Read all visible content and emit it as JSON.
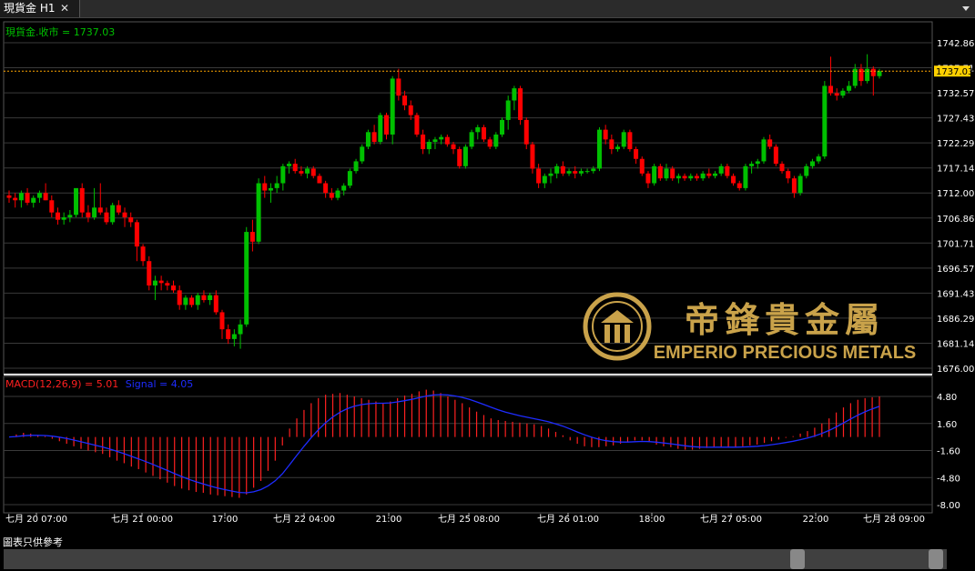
{
  "tab": {
    "title": "現貨金 H1",
    "close": "✕"
  },
  "price_legend": "現貨金.收市 = 1737.03",
  "current_price": "1737.03",
  "macd_legend": {
    "macd": "MACD(12,26,9) = 5.01",
    "signal": "Signal = 4.05"
  },
  "price_axis_labels": [
    "1742.86",
    "1737.71",
    "1732.57",
    "1727.43",
    "1722.29",
    "1717.14",
    "1712.00",
    "1706.86",
    "1701.71",
    "1696.57",
    "1691.43",
    "1686.29",
    "1681.14",
    "1676.00"
  ],
  "macd_axis_labels": [
    "4.80",
    "1.60",
    "-1.60",
    "-4.80",
    "-8.00"
  ],
  "time_labels": [
    "七月 20 07:00",
    "七月 21 00:00",
    "17:00",
    "七月 22 04:00",
    "21:00",
    "七月 25 08:00",
    "七月 26 01:00",
    "18:00",
    "七月 27 05:00",
    "22:00",
    "七月 28 09:00"
  ],
  "logo": {
    "chinese": "帝鋒貴金屬",
    "english": "EMPERIO PRECIOUS METALS"
  },
  "disclaimer": "圖表只供參考",
  "colors": {
    "up": "#00c000",
    "down": "#ff0000",
    "grid": "#3a3a3a",
    "axis_text": "#ffffff",
    "macd_bar": "#ff2020",
    "signal": "#1e2cff",
    "price_line": "#ffa500",
    "logo": "#c9a24a"
  },
  "chart_data": {
    "type": "candlestick",
    "ylim": [
      1676.0,
      1745.0
    ],
    "macd_ylim": [
      -8.0,
      6.0
    ],
    "candles": [
      [
        1711.5,
        1712.5,
        1710,
        1711
      ],
      [
        1711,
        1712,
        1709,
        1710.5
      ],
      [
        1710.5,
        1712.5,
        1709,
        1712
      ],
      [
        1712,
        1713,
        1709.5,
        1710
      ],
      [
        1710,
        1711.5,
        1709,
        1711
      ],
      [
        1711,
        1712.5,
        1710,
        1712
      ],
      [
        1712,
        1714,
        1710.5,
        1710.5
      ],
      [
        1710.5,
        1711.5,
        1707,
        1708
      ],
      [
        1708,
        1709,
        1705.5,
        1706.5
      ],
      [
        1706.5,
        1708,
        1705.5,
        1707
      ],
      [
        1707,
        1708.5,
        1706,
        1707.5
      ],
      [
        1707.5,
        1710,
        1707,
        1713
      ],
      [
        1713,
        1714,
        1707,
        1708
      ],
      [
        1708,
        1709.5,
        1706,
        1707
      ],
      [
        1707,
        1713,
        1706.5,
        1709
      ],
      [
        1709,
        1714,
        1707.5,
        1708
      ],
      [
        1708,
        1709,
        1705.5,
        1706
      ],
      [
        1706,
        1710,
        1705.5,
        1709.5
      ],
      [
        1709.5,
        1710.5,
        1707.5,
        1708
      ],
      [
        1708,
        1709,
        1705,
        1707
      ],
      [
        1707,
        1708,
        1705,
        1706
      ],
      [
        1706,
        1706.5,
        1698,
        1701
      ],
      [
        1701,
        1701.5,
        1697,
        1698
      ],
      [
        1698,
        1699,
        1692,
        1693
      ],
      [
        1693,
        1695,
        1690,
        1694
      ],
      [
        1694,
        1695,
        1692,
        1693.5
      ],
      [
        1693.5,
        1694,
        1692,
        1693
      ],
      [
        1693,
        1694,
        1691.5,
        1692
      ],
      [
        1692,
        1693,
        1688,
        1689
      ],
      [
        1689,
        1691,
        1688,
        1690.5
      ],
      [
        1690.5,
        1691,
        1688.5,
        1689
      ],
      [
        1689,
        1691.5,
        1688,
        1691
      ],
      [
        1691,
        1692,
        1689.5,
        1690
      ],
      [
        1690,
        1691.5,
        1689,
        1691
      ],
      [
        1691,
        1692,
        1687,
        1687.5
      ],
      [
        1687.5,
        1688,
        1682,
        1684
      ],
      [
        1684,
        1685,
        1681,
        1682
      ],
      [
        1682,
        1684,
        1680.5,
        1683
      ],
      [
        1683,
        1686,
        1680,
        1685
      ],
      [
        1685,
        1705,
        1684.5,
        1704
      ],
      [
        1704,
        1706.5,
        1700,
        1702
      ],
      [
        1702,
        1715,
        1701.5,
        1714
      ],
      [
        1714,
        1715.5,
        1711,
        1712.5
      ],
      [
        1712.5,
        1714,
        1710,
        1713
      ],
      [
        1713,
        1715.5,
        1712,
        1714
      ],
      [
        1714,
        1718,
        1712.5,
        1717.5
      ],
      [
        1717.5,
        1718.5,
        1716,
        1718
      ],
      [
        1718,
        1719,
        1716,
        1716.5
      ],
      [
        1716.5,
        1717.5,
        1715.5,
        1716
      ],
      [
        1716,
        1717.5,
        1715,
        1717
      ],
      [
        1717,
        1717.5,
        1715,
        1715.5
      ],
      [
        1715.5,
        1716,
        1714,
        1714
      ],
      [
        1714,
        1714.5,
        1711,
        1712
      ],
      [
        1712,
        1713,
        1710.5,
        1711
      ],
      [
        1711,
        1713,
        1710.5,
        1712.5
      ],
      [
        1712.5,
        1714,
        1711.5,
        1713.5
      ],
      [
        1713.5,
        1717,
        1713,
        1716.5
      ],
      [
        1716.5,
        1719,
        1716,
        1718.5
      ],
      [
        1718.5,
        1722,
        1718,
        1721.5
      ],
      [
        1721.5,
        1725,
        1721,
        1724.5
      ],
      [
        1724.5,
        1726,
        1722,
        1722.5
      ],
      [
        1722.5,
        1728.5,
        1722,
        1728
      ],
      [
        1728,
        1728.5,
        1723,
        1724
      ],
      [
        1724,
        1736,
        1722,
        1735.5
      ],
      [
        1735.5,
        1737.5,
        1731,
        1732
      ],
      [
        1732,
        1733,
        1729,
        1730
      ],
      [
        1730,
        1731,
        1727,
        1728
      ],
      [
        1728,
        1728.5,
        1723.5,
        1724
      ],
      [
        1724,
        1725,
        1720,
        1721
      ],
      [
        1721,
        1723,
        1720,
        1722.5
      ],
      [
        1722.5,
        1723.5,
        1721,
        1723
      ],
      [
        1723,
        1724,
        1722,
        1723.5
      ],
      [
        1723.5,
        1724,
        1721.5,
        1722
      ],
      [
        1722,
        1722.5,
        1720,
        1721
      ],
      [
        1721,
        1721.5,
        1717,
        1717.5
      ],
      [
        1717.5,
        1722,
        1717,
        1721.5
      ],
      [
        1721.5,
        1725,
        1721,
        1724.5
      ],
      [
        1724.5,
        1726,
        1723,
        1725.5
      ],
      [
        1725.5,
        1726,
        1722.5,
        1723
      ],
      [
        1723,
        1723.5,
        1721,
        1721.5
      ],
      [
        1721.5,
        1724.5,
        1721,
        1724
      ],
      [
        1724,
        1727.5,
        1723.5,
        1727
      ],
      [
        1727,
        1732,
        1725,
        1731
      ],
      [
        1731,
        1734,
        1729,
        1733.5
      ],
      [
        1733.5,
        1734,
        1726,
        1727
      ],
      [
        1727,
        1727.5,
        1721,
        1722
      ],
      [
        1722,
        1722.5,
        1716,
        1717
      ],
      [
        1717,
        1718,
        1713,
        1714
      ],
      [
        1714,
        1716,
        1713,
        1715.5
      ],
      [
        1715.5,
        1717,
        1714,
        1716
      ],
      [
        1716,
        1718,
        1715,
        1717.5
      ],
      [
        1717.5,
        1718.5,
        1715.5,
        1716
      ],
      [
        1716,
        1717,
        1715.5,
        1716.5
      ],
      [
        1716.5,
        1717.5,
        1715,
        1716
      ],
      [
        1716,
        1717,
        1715.5,
        1716.5
      ],
      [
        1716.5,
        1717,
        1716,
        1716.5
      ],
      [
        1716.5,
        1717.5,
        1716,
        1717
      ],
      [
        1717,
        1725.5,
        1716.5,
        1725
      ],
      [
        1725,
        1726,
        1722,
        1723
      ],
      [
        1723,
        1724,
        1720,
        1721
      ],
      [
        1721,
        1722,
        1720.5,
        1721.5
      ],
      [
        1721.5,
        1725,
        1721,
        1724.5
      ],
      [
        1724.5,
        1725,
        1720.5,
        1721
      ],
      [
        1721,
        1721.5,
        1718,
        1719
      ],
      [
        1719,
        1719.5,
        1715.5,
        1716
      ],
      [
        1716,
        1716.5,
        1713,
        1714
      ],
      [
        1714,
        1718,
        1713.5,
        1717.5
      ],
      [
        1717.5,
        1718,
        1714.5,
        1715
      ],
      [
        1715,
        1718,
        1714.5,
        1717
      ],
      [
        1717,
        1717.5,
        1714.5,
        1715
      ],
      [
        1715,
        1716,
        1714,
        1715.5
      ],
      [
        1715.5,
        1716,
        1714.5,
        1715
      ],
      [
        1715,
        1716,
        1714.5,
        1715.5
      ],
      [
        1715.5,
        1716,
        1714.5,
        1715
      ],
      [
        1715,
        1716.5,
        1714.5,
        1716
      ],
      [
        1716,
        1717,
        1715,
        1715.5
      ],
      [
        1715.5,
        1716.5,
        1715,
        1716
      ],
      [
        1716,
        1718,
        1715.5,
        1717.5
      ],
      [
        1717.5,
        1718,
        1715,
        1715.5
      ],
      [
        1715.5,
        1716,
        1713.5,
        1714
      ],
      [
        1714,
        1714.5,
        1712.5,
        1713
      ],
      [
        1713,
        1718,
        1712.5,
        1717.5
      ],
      [
        1717.5,
        1718.5,
        1716,
        1718
      ],
      [
        1718,
        1719,
        1717,
        1718.5
      ],
      [
        1718.5,
        1723.5,
        1718,
        1723
      ],
      [
        1723,
        1724,
        1721,
        1721.5
      ],
      [
        1721.5,
        1722,
        1717.5,
        1718
      ],
      [
        1718,
        1718.5,
        1716,
        1716.5
      ],
      [
        1716.5,
        1717,
        1714,
        1715
      ],
      [
        1715,
        1715.5,
        1711,
        1712
      ],
      [
        1712,
        1716,
        1711.5,
        1715.5
      ],
      [
        1715.5,
        1718,
        1715,
        1717.5
      ],
      [
        1717.5,
        1719,
        1717,
        1718.5
      ],
      [
        1718.5,
        1720,
        1718,
        1719.5
      ],
      [
        1719.5,
        1735,
        1719,
        1734
      ],
      [
        1734,
        1740,
        1732,
        1732.5
      ],
      [
        1732.5,
        1733.5,
        1731,
        1732
      ],
      [
        1732,
        1733.5,
        1731.5,
        1733
      ],
      [
        1733,
        1735,
        1732.5,
        1734
      ],
      [
        1734,
        1738.5,
        1733.5,
        1737.5
      ],
      [
        1737.5,
        1738.5,
        1734,
        1735
      ],
      [
        1735,
        1740.5,
        1734.5,
        1737.5
      ],
      [
        1737.5,
        1738,
        1732,
        1736
      ],
      [
        1736,
        1737.5,
        1735.5,
        1737.03
      ]
    ],
    "macd_hist": [
      0,
      0.3,
      0.5,
      0.4,
      0.2,
      0.1,
      -0.2,
      -0.5,
      -0.8,
      -1.1,
      -1.4,
      -1.6,
      -1.8,
      -2.0,
      -2.4,
      -2.8,
      -3.1,
      -3.5,
      -3.8,
      -4.2,
      -4.6,
      -5.0,
      -5.4,
      -5.8,
      -6.1,
      -6.3,
      -6.5,
      -6.6,
      -6.8,
      -6.9,
      -7.0,
      -7.1,
      -7.2,
      -6.8,
      -6.0,
      -5.2,
      -4.0,
      -2.8,
      -1.0,
      1.0,
      2.2,
      3.2,
      4.0,
      4.6,
      5.0,
      5.1,
      5.2,
      5.0,
      4.8,
      4.6,
      4.4,
      4.2,
      4.0,
      4.2,
      4.6,
      4.9,
      5.1,
      5.4,
      5.6,
      5.5,
      5.2,
      4.8,
      4.4,
      4.0,
      3.5,
      3.0,
      2.6,
      2.2,
      2.0,
      1.9,
      1.8,
      1.7,
      1.6,
      1.5,
      1.3,
      1.0,
      0.6,
      0.2,
      -0.4,
      -0.8,
      -1.1,
      -1.2,
      -1.2,
      -1.1,
      -1.0,
      -0.8,
      -0.6,
      -0.4,
      -0.4,
      -0.6,
      -0.9,
      -1.1,
      -1.2,
      -1.4,
      -1.5,
      -1.5,
      -1.4,
      -1.3,
      -1.2,
      -1.2,
      -1.2,
      -1.2,
      -1.1,
      -1.0,
      -0.9,
      -0.7,
      -0.5,
      -0.3,
      -0.1,
      0.1,
      0.4,
      0.7,
      1.1,
      1.6,
      2.2,
      2.9,
      3.5,
      4.0,
      4.4,
      4.6,
      4.7,
      4.8
    ]
  }
}
